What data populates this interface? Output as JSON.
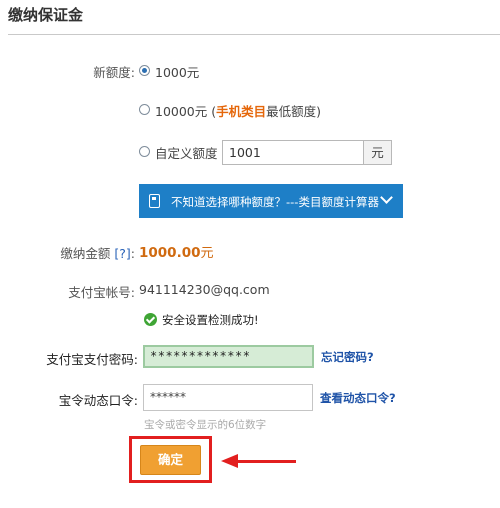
{
  "page": {
    "title": "缴纳保证金"
  },
  "deposit": {
    "label": "新额度:",
    "options": [
      {
        "label": "1000元",
        "checked": true
      },
      {
        "label_prefix": "10000元 (",
        "label_highlight": "手机类目",
        "label_suffix": "最低额度)",
        "checked": false
      },
      {
        "label": "自定义额度",
        "checked": false
      }
    ],
    "custom_value": "1001",
    "custom_unit": "元"
  },
  "calculator": {
    "text": "不知道选择哪种额度？---类目额度计算器"
  },
  "amount": {
    "label": "缴纳金额",
    "help": "[?]",
    "colon": ":",
    "value": "1000.00",
    "unit": "元"
  },
  "account": {
    "label": "支付宝帐号:",
    "value": "941114230@qq.com"
  },
  "security": {
    "status": "安全设置检测成功!"
  },
  "password": {
    "label": "支付宝支付密码:",
    "value": "*************",
    "forgot_link": "忘记密码?"
  },
  "otp": {
    "label": "宝令动态口令:",
    "value": "******",
    "view_link": "查看动态口令?",
    "hint": "宝令或密令显示的6位数字"
  },
  "submit": {
    "label": "确定"
  },
  "colors": {
    "accent_orange": "#f0a032",
    "highlight_red": "#e21f1f",
    "bar_blue": "#1e7fc7",
    "success_green": "#3fa535"
  }
}
